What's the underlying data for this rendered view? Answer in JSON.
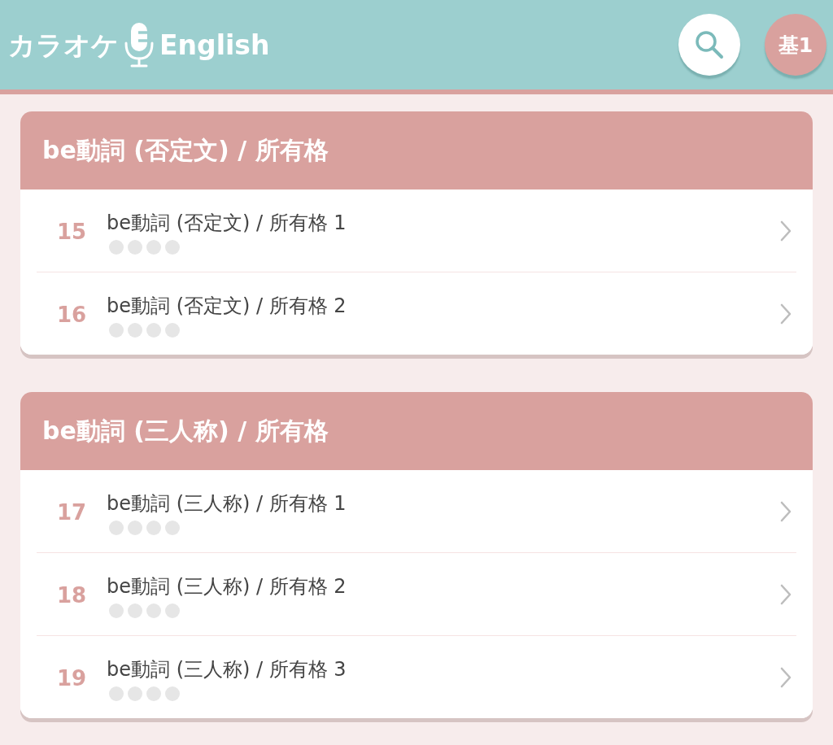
{
  "header": {
    "logo_text_jp": "カラオケ",
    "logo_text_en": "English",
    "level_badge": "基1"
  },
  "sections": [
    {
      "title": "be動詞 (否定文) / 所有格",
      "lessons": [
        {
          "number": "15",
          "title": "be動詞 (否定文) / 所有格 1",
          "stars": 0
        },
        {
          "number": "16",
          "title": "be動詞 (否定文) / 所有格 2",
          "stars": 0
        }
      ]
    },
    {
      "title": "be動詞 (三人称) / 所有格",
      "lessons": [
        {
          "number": "17",
          "title": "be動詞 (三人称) / 所有格 1",
          "stars": 0
        },
        {
          "number": "18",
          "title": "be動詞 (三人称) / 所有格 2",
          "stars": 0
        },
        {
          "number": "19",
          "title": "be動詞 (三人称) / 所有格 3",
          "stars": 0
        }
      ]
    }
  ]
}
